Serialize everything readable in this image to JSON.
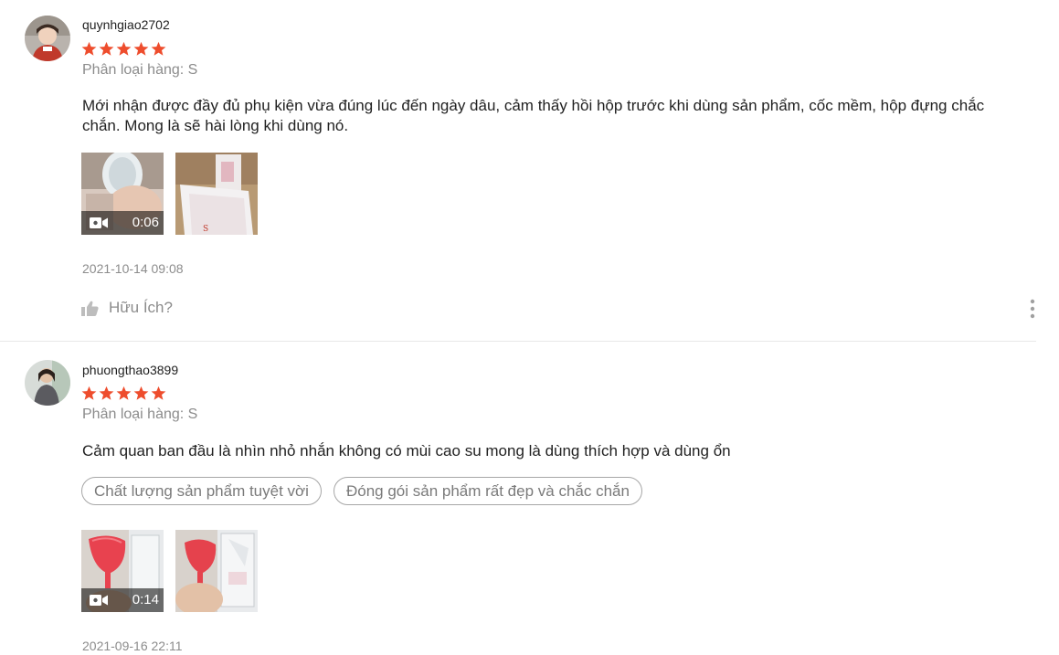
{
  "reviews": [
    {
      "username": "quynhgiao2702",
      "rating": 5,
      "variation": "Phân loại hàng: S",
      "comment": "Mới nhận được đầy đủ phụ kiện vừa đúng lúc đến ngày dâu, cảm thấy hồi hộp trước khi dùng sản phẩm, cốc mềm, hộp đựng chắc chắn. Mong là sẽ hài lòng khi dùng nó.",
      "video_duration": "0:06",
      "timestamp": "2021-10-14 09:08",
      "helpful_label": "Hữu Ích?"
    },
    {
      "username": "phuongthao3899",
      "rating": 5,
      "variation": "Phân loại hàng: S",
      "comment": "Cảm quan ban đầu là nhìn nhỏ nhắn không có mùi cao su mong là dùng thích hợp và dùng ổn",
      "tags": [
        "Chất lượng sản phẩm tuyệt vời",
        "Đóng gói sản phẩm rất đẹp và chắc chắn"
      ],
      "video_duration": "0:14",
      "timestamp": "2021-09-16 22:11"
    }
  ],
  "colors": {
    "star": "#ee4d2d",
    "muted_text": "#8c8c8c"
  },
  "icons": {
    "star": "star-icon",
    "video": "video-camera-icon",
    "helpful": "thumbs-up-icon",
    "more": "more-vertical-icon"
  }
}
